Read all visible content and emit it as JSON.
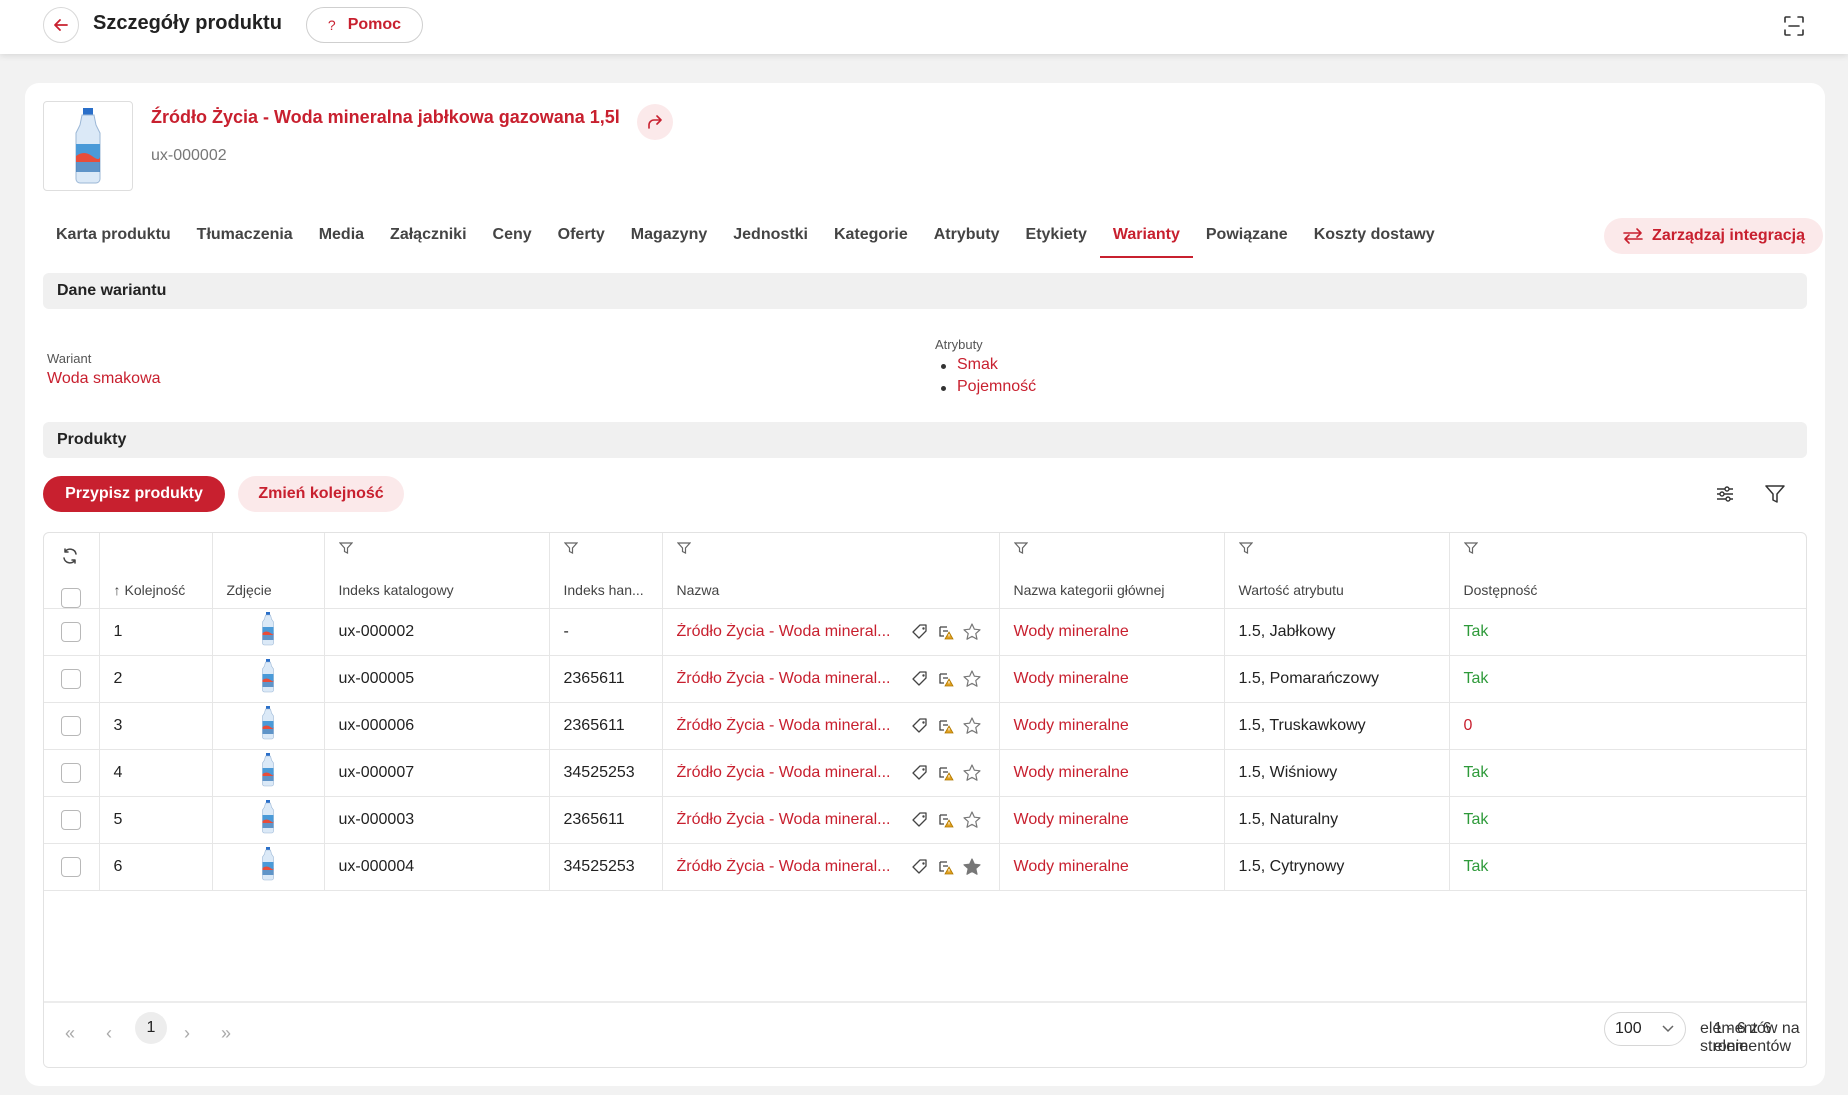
{
  "header": {
    "title": "Szczegóły produktu",
    "help_label": "Pomoc",
    "help_icon": "?"
  },
  "product": {
    "title": "Źródło Życia - Woda mineralna jabłkowa gazowana 1,5l",
    "code": "ux-000002"
  },
  "tabs": [
    {
      "label": "Karta produktu"
    },
    {
      "label": "Tłumaczenia"
    },
    {
      "label": "Media"
    },
    {
      "label": "Załączniki"
    },
    {
      "label": "Ceny"
    },
    {
      "label": "Oferty"
    },
    {
      "label": "Magazyny"
    },
    {
      "label": "Jednostki"
    },
    {
      "label": "Kategorie"
    },
    {
      "label": "Atrybuty"
    },
    {
      "label": "Etykiety"
    },
    {
      "label": "Warianty",
      "active": true
    },
    {
      "label": "Powiązane"
    },
    {
      "label": "Koszty dostawy"
    }
  ],
  "manage_integration_label": "Zarządzaj integracją",
  "variant_section": {
    "title": "Dane wariantu",
    "variant_label": "Wariant",
    "variant_value": "Woda smakowa",
    "attributes_label": "Atrybuty",
    "attributes": [
      "Smak",
      "Pojemność"
    ]
  },
  "products_section": {
    "title": "Produkty",
    "assign_label": "Przypisz produkty",
    "reorder_label": "Zmień kolejność"
  },
  "table": {
    "columns": {
      "order": "Kolejność",
      "photo": "Zdjęcie",
      "catalog_index": "Indeks katalogowy",
      "trade_index": "Indeks han...",
      "name": "Nazwa",
      "main_category": "Nazwa kategorii głównej",
      "attribute_value": "Wartość atrybutu",
      "availability": "Dostępność"
    },
    "rows": [
      {
        "order": "1",
        "catalog_index": "ux-000002",
        "trade_index": "-",
        "name": "Źródło Życia - Woda mineral...",
        "category": "Wody mineralne",
        "attribute_value": "1.5, Jabłkowy",
        "availability": "Tak",
        "available": true,
        "starred": false
      },
      {
        "order": "2",
        "catalog_index": "ux-000005",
        "trade_index": "2365611",
        "name": "Źródło Życia - Woda mineral...",
        "category": "Wody mineralne",
        "attribute_value": "1.5, Pomarańczowy",
        "availability": "Tak",
        "available": true,
        "starred": false
      },
      {
        "order": "3",
        "catalog_index": "ux-000006",
        "trade_index": "2365611",
        "name": "Źródło Życia - Woda mineral...",
        "category": "Wody mineralne",
        "attribute_value": "1.5, Truskawkowy",
        "availability": "0",
        "available": false,
        "starred": false
      },
      {
        "order": "4",
        "catalog_index": "ux-000007",
        "trade_index": "34525253",
        "name": "Źródło Życia - Woda mineral...",
        "category": "Wody mineralne",
        "attribute_value": "1.5, Wiśniowy",
        "availability": "Tak",
        "available": true,
        "starred": false
      },
      {
        "order": "5",
        "catalog_index": "ux-000003",
        "trade_index": "2365611",
        "name": "Źródło Życia - Woda mineral...",
        "category": "Wody mineralne",
        "attribute_value": "1.5, Naturalny",
        "availability": "Tak",
        "available": true,
        "starred": false
      },
      {
        "order": "6",
        "catalog_index": "ux-000004",
        "trade_index": "34525253",
        "name": "Źródło Życia - Woda mineral...",
        "category": "Wody mineralne",
        "attribute_value": "1.5, Cytrynowy",
        "availability": "Tak",
        "available": true,
        "starred": true
      }
    ]
  },
  "pagination": {
    "current_page": "1",
    "page_size": "100",
    "per_page_label": "elementów na stronie",
    "summary": "1 - 6 z 6 elementów"
  },
  "colors": {
    "accent": "#c8202f",
    "accent_light": "#fbe9ea",
    "available_green": "#2e9a3a"
  },
  "icons": {
    "back": "arrow-left-icon",
    "fullscreen": "fullscreen-icon",
    "share": "share-icon",
    "integration": "swap-arrows-icon",
    "settings": "sliders-icon",
    "filter": "filter-icon",
    "refresh": "refresh-icon",
    "tag": "tag-icon",
    "hierarchy": "hierarchy-icon",
    "star": "star-icon"
  }
}
